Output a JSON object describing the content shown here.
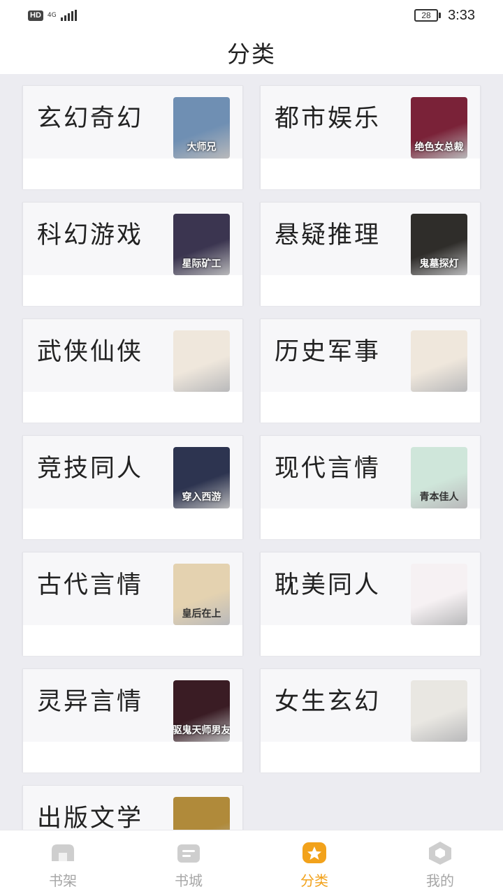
{
  "status_bar": {
    "hd_badge": "HD",
    "network_type": "4G",
    "battery_level": "28",
    "time": "3:33"
  },
  "header": {
    "title": "分类"
  },
  "categories": [
    {
      "label": "玄幻奇幻",
      "cover_icon": "book-cover-fantasy",
      "cover_text": "大师兄",
      "cover_color": "#6f8fb3"
    },
    {
      "label": "都市娱乐",
      "cover_icon": "book-cover-urban",
      "cover_text": "绝色女总裁",
      "cover_color": "#7a2238"
    },
    {
      "label": "科幻游戏",
      "cover_icon": "book-cover-scifi",
      "cover_text": "星际矿工",
      "cover_color": "#3b3550"
    },
    {
      "label": "悬疑推理",
      "cover_icon": "book-cover-mystery",
      "cover_text": "鬼墓探灯",
      "cover_color": "#2f2d2a"
    },
    {
      "label": "武侠仙侠",
      "cover_icon": "book-cover-wuxia",
      "cover_text": "",
      "cover_color": "#efe7dc"
    },
    {
      "label": "历史军事",
      "cover_icon": "book-cover-history",
      "cover_text": "",
      "cover_color": "#efe7dc"
    },
    {
      "label": "竞技同人",
      "cover_icon": "book-cover-competition",
      "cover_text": "穿入西游",
      "cover_color": "#2d3450"
    },
    {
      "label": "现代言情",
      "cover_icon": "book-cover-modern-romance",
      "cover_text": "青本佳人",
      "cover_color": "#cfe6da"
    },
    {
      "label": "古代言情",
      "cover_icon": "book-cover-ancient-romance",
      "cover_text": "皇后在上",
      "cover_color": "#e4d2b0"
    },
    {
      "label": "耽美同人",
      "cover_icon": "book-cover-bl",
      "cover_text": "",
      "cover_color": "#f6f1f3"
    },
    {
      "label": "灵异言情",
      "cover_icon": "book-cover-supernatural",
      "cover_text": "驱鬼天师男友",
      "cover_color": "#3a1c24"
    },
    {
      "label": "女生玄幻",
      "cover_icon": "book-cover-female-fantasy",
      "cover_text": "",
      "cover_color": "#e9e7e2"
    },
    {
      "label": "出版文学",
      "cover_icon": "book-cover-published",
      "cover_text": "",
      "cover_color": "#b08a3a"
    }
  ],
  "tabbar": {
    "items": [
      {
        "label": "书架",
        "icon": "bookshelf-icon",
        "active": false
      },
      {
        "label": "书城",
        "icon": "bookstore-icon",
        "active": false
      },
      {
        "label": "分类",
        "icon": "category-star-icon",
        "active": true
      },
      {
        "label": "我的",
        "icon": "profile-hexagon-icon",
        "active": false
      }
    ],
    "active_color": "#f2a21b",
    "inactive_color": "#a6a6a6"
  }
}
